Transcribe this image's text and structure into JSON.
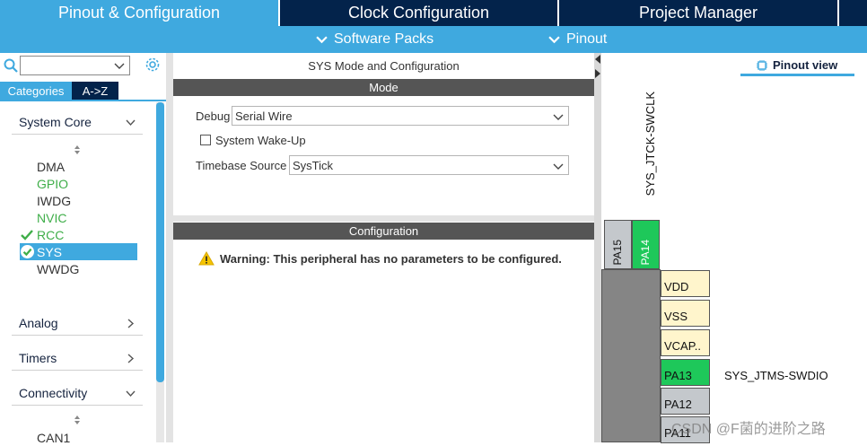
{
  "colors": {
    "accent": "#3fa9df",
    "navy": "#03234b",
    "green_pin": "#1ec85a",
    "power_pin": "#fff5cc",
    "gray_pin": "#c4c8cc",
    "check_green": "#3fae49"
  },
  "top_tabs": {
    "pinout": "Pinout & Configuration",
    "clock": "Clock Configuration",
    "project": "Project Manager"
  },
  "sub_bar": {
    "software_packs": "Software Packs",
    "pinout": "Pinout"
  },
  "sidebar": {
    "search": {
      "value": "",
      "icon": "search-icon"
    },
    "tabs": {
      "categories": "Categories",
      "az": "A->Z"
    },
    "groups": {
      "system_core": "System Core",
      "analog": "Analog",
      "timers": "Timers",
      "connectivity": "Connectivity"
    },
    "system_core_items": [
      {
        "label": "DMA",
        "state": "normal"
      },
      {
        "label": "GPIO",
        "state": "green"
      },
      {
        "label": "IWDG",
        "state": "normal"
      },
      {
        "label": "NVIC",
        "state": "green"
      },
      {
        "label": "RCC",
        "state": "checked"
      },
      {
        "label": "SYS",
        "state": "selected"
      },
      {
        "label": "WWDG",
        "state": "normal"
      }
    ],
    "connectivity_items": [
      {
        "label": "CAN1"
      }
    ]
  },
  "mode_panel": {
    "title": "SYS Mode and Configuration",
    "mode_header": "Mode",
    "debug_label": "Debug",
    "debug_value": "Serial Wire",
    "wakeup_label": "System Wake-Up",
    "wakeup_checked": false,
    "timebase_label": "Timebase Source",
    "timebase_value": "SysTick",
    "config_header": "Configuration",
    "warning": "Warning: This peripheral has no parameters to be configured."
  },
  "pinout": {
    "view_label": "Pinout view",
    "top_signal": "SYS_JTCK-SWCLK",
    "top_pins": [
      {
        "label": "PA15",
        "state": "gray"
      },
      {
        "label": "PA14",
        "state": "green"
      }
    ],
    "side_pins": [
      {
        "label": "VDD",
        "state": "power"
      },
      {
        "label": "VSS",
        "state": "power"
      },
      {
        "label": "VCAP..",
        "state": "power"
      },
      {
        "label": "PA13",
        "state": "green"
      },
      {
        "label": "PA12",
        "state": "gray"
      },
      {
        "label": "PA11",
        "state": "gray"
      }
    ],
    "side_signal": "SYS_JTMS-SWDIO"
  },
  "watermark": "CSDN @F菌的进阶之路"
}
